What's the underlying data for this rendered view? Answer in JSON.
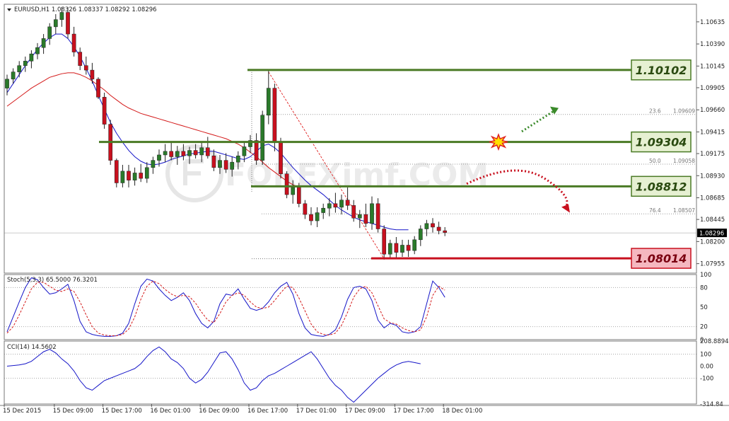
{
  "chart_data": [
    {
      "type": "candlestick",
      "title": "EURUSD,H1  1.08326 1.08337 1.08292 1.08296",
      "symbol": "EURUSD",
      "timeframe": "H1",
      "ohlc_header": "1.08326 1.08337 1.08292 1.08296",
      "current_price": "1.08296",
      "ylim": [
        1.0785,
        1.1083
      ],
      "y_ticks": [
        "1.10635",
        "1.10390",
        "1.10145",
        "1.09905",
        "1.09660",
        "1.09415",
        "1.09175",
        "1.08930",
        "1.08685",
        "1.08445",
        "1.08200",
        "1.07955"
      ],
      "x_ticks": [
        "15 Dec 2015",
        "15 Dec 09:00",
        "15 Dec 17:00",
        "16 Dec 01:00",
        "16 Dec 09:00",
        "16 Dec 17:00",
        "17 Dec 01:00",
        "17 Dec 09:00",
        "17 Dec 17:00",
        "18 Dec 01:00"
      ],
      "candles": [
        [
          1.099,
          1.1005,
          1.0982,
          1.1
        ],
        [
          1.1,
          1.1012,
          1.0995,
          1.1008
        ],
        [
          1.1008,
          1.102,
          1.1002,
          1.1015
        ],
        [
          1.1015,
          1.1025,
          1.1008,
          1.102
        ],
        [
          1.102,
          1.1032,
          1.1012,
          1.1028
        ],
        [
          1.1028,
          1.104,
          1.1022,
          1.1035
        ],
        [
          1.1035,
          1.105,
          1.1028,
          1.1045
        ],
        [
          1.1045,
          1.1062,
          1.1038,
          1.1058
        ],
        [
          1.1058,
          1.1072,
          1.105,
          1.1066
        ],
        [
          1.1066,
          1.108,
          1.1058,
          1.1074
        ],
        [
          1.1074,
          1.108,
          1.1045,
          1.105
        ],
        [
          1.105,
          1.1058,
          1.1025,
          1.103
        ],
        [
          1.103,
          1.1035,
          1.101,
          1.1015
        ],
        [
          1.1015,
          1.1025,
          1.1005,
          1.101
        ],
        [
          1.101,
          1.1018,
          1.0995,
          1.1
        ],
        [
          1.1,
          1.1002,
          1.0978,
          1.098
        ],
        [
          1.098,
          1.0985,
          1.0945,
          1.095
        ],
        [
          1.095,
          1.0955,
          1.0905,
          1.091
        ],
        [
          1.091,
          1.0912,
          1.088,
          1.0885
        ],
        [
          1.0885,
          1.0905,
          1.088,
          1.0898
        ],
        [
          1.0898,
          1.0905,
          1.088,
          1.0888
        ],
        [
          1.0888,
          1.0902,
          1.0882,
          1.0896
        ],
        [
          1.0896,
          1.0906,
          1.0886,
          1.089
        ],
        [
          1.089,
          1.0908,
          1.0885,
          1.0902
        ],
        [
          1.0902,
          1.0914,
          1.0895,
          1.091
        ],
        [
          1.091,
          1.0922,
          1.0903,
          1.0916
        ],
        [
          1.0916,
          1.0928,
          1.0908,
          1.092
        ],
        [
          1.092,
          1.093,
          1.091,
          1.0914
        ],
        [
          1.0914,
          1.0926,
          1.0905,
          1.092
        ],
        [
          1.092,
          1.0928,
          1.091,
          1.0915
        ],
        [
          1.0915,
          1.0925,
          1.0906,
          1.0921
        ],
        [
          1.0921,
          1.0928,
          1.0912,
          1.0916
        ],
        [
          1.0916,
          1.093,
          1.0908,
          1.0924
        ],
        [
          1.0924,
          1.0936,
          1.0912,
          1.0915
        ],
        [
          1.0915,
          1.0922,
          1.0898,
          1.0902
        ],
        [
          1.0902,
          1.0916,
          1.0895,
          1.091
        ],
        [
          1.091,
          1.0918,
          1.0896,
          1.09
        ],
        [
          1.09,
          1.0914,
          1.0892,
          1.0908
        ],
        [
          1.0908,
          1.092,
          1.09,
          1.0915
        ],
        [
          1.0915,
          1.093,
          1.0908,
          1.0925
        ],
        [
          1.0925,
          1.0938,
          1.0918,
          1.0932
        ],
        [
          1.0932,
          1.094,
          1.0905,
          1.091
        ],
        [
          1.091,
          1.0965,
          1.0905,
          1.096
        ],
        [
          1.096,
          1.101,
          1.095,
          1.099
        ],
        [
          1.099,
          1.0995,
          1.092,
          1.093
        ],
        [
          1.093,
          1.0935,
          1.089,
          1.0895
        ],
        [
          1.0895,
          1.0898,
          1.0868,
          1.0872
        ],
        [
          1.0872,
          1.0888,
          1.0862,
          1.088
        ],
        [
          1.088,
          1.0885,
          1.0858,
          1.0862
        ],
        [
          1.0862,
          1.0866,
          1.0845,
          1.085
        ],
        [
          1.085,
          1.0858,
          1.0838,
          1.0843
        ],
        [
          1.0843,
          1.0858,
          1.0836,
          1.0852
        ],
        [
          1.0852,
          1.0862,
          1.0845,
          1.0857
        ],
        [
          1.0857,
          1.0868,
          1.0848,
          1.0862
        ],
        [
          1.0862,
          1.0874,
          1.0852,
          1.0858
        ],
        [
          1.0858,
          1.0872,
          1.085,
          1.0866
        ],
        [
          1.0866,
          1.088,
          1.0855,
          1.086
        ],
        [
          1.086,
          1.0866,
          1.0842,
          1.0846
        ],
        [
          1.0846,
          1.0855,
          1.0835,
          1.085
        ],
        [
          1.085,
          1.0862,
          1.0836,
          1.084
        ],
        [
          1.084,
          1.087,
          1.0833,
          1.0862
        ],
        [
          1.0862,
          1.0868,
          1.083,
          1.0834
        ],
        [
          1.0834,
          1.0838,
          1.08,
          1.0806
        ],
        [
          1.0806,
          1.0822,
          1.0801,
          1.0818
        ],
        [
          1.0818,
          1.0825,
          1.0802,
          1.0808
        ],
        [
          1.0808,
          1.0822,
          1.0803,
          1.0816
        ],
        [
          1.0816,
          1.0822,
          1.0803,
          1.081
        ],
        [
          1.081,
          1.0826,
          1.0806,
          1.0822
        ],
        [
          1.0822,
          1.0838,
          1.0815,
          1.0834
        ],
        [
          1.0834,
          1.0844,
          1.0826,
          1.084
        ],
        [
          1.084,
          1.0846,
          1.083,
          1.0836
        ],
        [
          1.0836,
          1.0842,
          1.0828,
          1.0832
        ],
        [
          1.0832,
          1.0836,
          1.0826,
          1.083
        ]
      ],
      "moving_averages": [
        {
          "color": "#1515c8",
          "values": [
            1.0985,
            1.0995,
            1.1005,
            1.1015,
            1.1024,
            1.1033,
            1.104,
            1.1046,
            1.105,
            1.105,
            1.1045,
            1.1036,
            1.1025,
            1.1012,
            1.0998,
            1.0982,
            1.0967,
            1.0952,
            1.094,
            1.093,
            1.0921,
            1.0914,
            1.0909,
            1.0906,
            1.0905,
            1.0906,
            1.0908,
            1.0911,
            1.0913,
            1.0915,
            1.0917,
            1.0918,
            1.0919,
            1.092,
            1.092,
            1.0918,
            1.0916,
            1.0914,
            1.0912,
            1.0911,
            1.0914,
            1.092,
            1.0926,
            1.0928,
            1.0924,
            1.0918,
            1.091,
            1.0902,
            1.0895,
            1.0888,
            1.0882,
            1.0877,
            1.0872,
            1.0866,
            1.086,
            1.0855,
            1.0851,
            1.0847,
            1.0844,
            1.0842,
            1.084,
            1.0838,
            1.0836,
            1.0834,
            1.0833,
            1.0833,
            1.0833
          ]
        },
        {
          "color": "#d41a1a",
          "values": [
            1.097,
            1.0975,
            1.098,
            1.0985,
            1.099,
            1.0994,
            1.0998,
            1.1002,
            1.1004,
            1.1006,
            1.1007,
            1.1007,
            1.1005,
            1.1002,
            1.0998,
            1.0993,
            1.0988,
            1.0982,
            1.0977,
            1.0972,
            1.0968,
            1.0965,
            1.0962,
            1.096,
            1.0958,
            1.0956,
            1.0954,
            1.0952,
            1.095,
            1.0948,
            1.0946,
            1.0944,
            1.0942,
            1.094,
            1.0938,
            1.0936,
            1.0934,
            1.0931,
            1.0928,
            1.0924,
            1.0919,
            1.0914,
            1.0908,
            1.0902,
            1.0897,
            1.0892,
            1.0887,
            1.0883,
            1.088
          ]
        }
      ],
      "levels": [
        {
          "label": "1.10102",
          "value": 1.10102,
          "color": "#4a7a25"
        },
        {
          "label": "1.09304",
          "value": 1.09304,
          "color": "#4a7a25"
        },
        {
          "label": "1.08812",
          "value": 1.08812,
          "color": "#4a7a25"
        },
        {
          "label": "1.08014",
          "value": 1.08014,
          "color": "#c8101e"
        }
      ],
      "fibonacci": [
        {
          "ratio": "23.6",
          "label": "1.09609",
          "value": 1.09609
        },
        {
          "ratio": "50.0",
          "label": "1.09058",
          "value": 1.09058
        },
        {
          "ratio": "76.4",
          "label": "1.08507",
          "value": 1.08507
        }
      ],
      "watermark": "FOREXimf.COM"
    },
    {
      "type": "line",
      "title": "Stoch(5,3,3) 65.5000 76.3201",
      "ylim": [
        0,
        100
      ],
      "y_ticks": [
        "100",
        "80",
        "50",
        "20",
        "0"
      ],
      "series": [
        {
          "color": "#1515c8",
          "values": [
            12,
            35,
            58,
            80,
            95,
            92,
            80,
            70,
            72,
            78,
            85,
            60,
            28,
            12,
            8,
            6,
            5,
            5,
            6,
            10,
            25,
            55,
            82,
            93,
            90,
            78,
            68,
            60,
            65,
            72,
            60,
            40,
            25,
            18,
            28,
            55,
            70,
            68,
            78,
            62,
            48,
            45,
            48,
            58,
            72,
            82,
            88,
            70,
            40,
            18,
            8,
            6,
            5,
            8,
            15,
            35,
            62,
            80,
            82,
            78,
            60,
            30,
            18,
            25,
            22,
            12,
            10,
            12,
            20,
            55,
            90,
            80,
            65
          ]
        },
        {
          "color": "#d41a1a",
          "values": [
            10,
            20,
            38,
            58,
            78,
            88,
            88,
            82,
            76,
            74,
            78,
            74,
            58,
            38,
            20,
            10,
            7,
            6,
            6,
            8,
            16,
            35,
            62,
            82,
            90,
            86,
            77,
            70,
            66,
            68,
            66,
            56,
            42,
            30,
            26,
            40,
            58,
            68,
            72,
            68,
            58,
            50,
            48,
            50,
            60,
            72,
            82,
            80,
            64,
            44,
            24,
            12,
            8,
            7,
            10,
            22,
            42,
            65,
            78,
            82,
            72,
            52,
            32,
            26,
            24,
            18,
            14,
            12,
            15,
            35,
            68,
            82,
            76
          ]
        }
      ]
    },
    {
      "type": "line",
      "title": "CCI(14) 14.5602",
      "ylim": [
        -314.84,
        208.89
      ],
      "y_ticks": [
        "208.8894",
        "100",
        "0.00",
        "-100",
        "-314.84"
      ],
      "series": [
        {
          "color": "#1515c8",
          "values": [
            0,
            5,
            10,
            20,
            40,
            80,
            120,
            140,
            110,
            60,
            20,
            -40,
            -120,
            -180,
            -200,
            -160,
            -120,
            -100,
            -80,
            -60,
            -40,
            -20,
            20,
            80,
            130,
            160,
            120,
            60,
            30,
            -20,
            -100,
            -140,
            -110,
            -50,
            30,
            110,
            120,
            60,
            -30,
            -140,
            -200,
            -180,
            -120,
            -80,
            -60,
            -30,
            0,
            30,
            60,
            90,
            120,
            60,
            -20,
            -100,
            -160,
            -200,
            -260,
            -300,
            -250,
            -200,
            -150,
            -100,
            -60,
            -20,
            10,
            30,
            40,
            30,
            20
          ]
        }
      ]
    }
  ]
}
